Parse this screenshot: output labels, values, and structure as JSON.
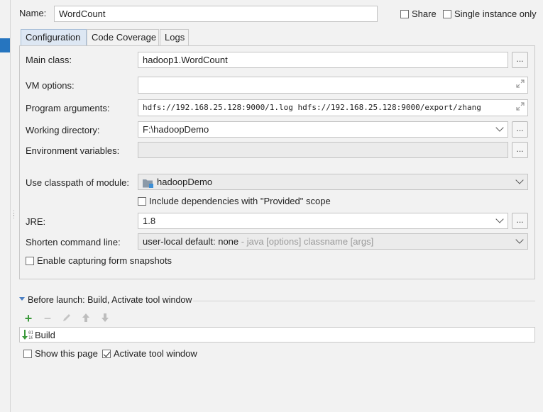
{
  "header": {
    "name_label": "Name:",
    "name_value": "WordCount",
    "share_label": "Share",
    "single_instance_label": "Single instance only"
  },
  "tabs": [
    {
      "label": "Configuration",
      "active": true
    },
    {
      "label": "Code Coverage",
      "active": false
    },
    {
      "label": "Logs",
      "active": false
    }
  ],
  "form": {
    "main_class_label": "Main class:",
    "main_class_value": "hadoop1.WordCount",
    "vm_options_label": "VM options:",
    "vm_options_value": "",
    "program_args_label": "Program arguments:",
    "program_args_value": "hdfs://192.168.25.128:9000/1.log hdfs://192.168.25.128:9000/export/zhang",
    "working_dir_label": "Working directory:",
    "working_dir_value": "F:\\hadoopDemo",
    "env_vars_label": "Environment variables:",
    "env_vars_value": "",
    "classpath_label": "Use classpath of module:",
    "classpath_value": "hadoopDemo",
    "include_deps_label": "Include dependencies with \"Provided\" scope",
    "jre_label": "JRE:",
    "jre_value": "1.8",
    "shorten_label": "Shorten command line:",
    "shorten_value": "user-local default: none",
    "shorten_hint": " - java [options] classname [args]",
    "enable_snapshots_label": "Enable capturing form snapshots",
    "browse_label": "..."
  },
  "before_launch": {
    "title": "Before launch: Build, Activate tool window",
    "items": [
      {
        "label": "Build"
      }
    ]
  },
  "footer": {
    "show_page_label": "Show this page",
    "activate_tool_label": "Activate tool window"
  },
  "colors": {
    "selection_blue": "#2675bf",
    "active_tab": "#dde7f3",
    "add_green": "#3c9a3c"
  }
}
